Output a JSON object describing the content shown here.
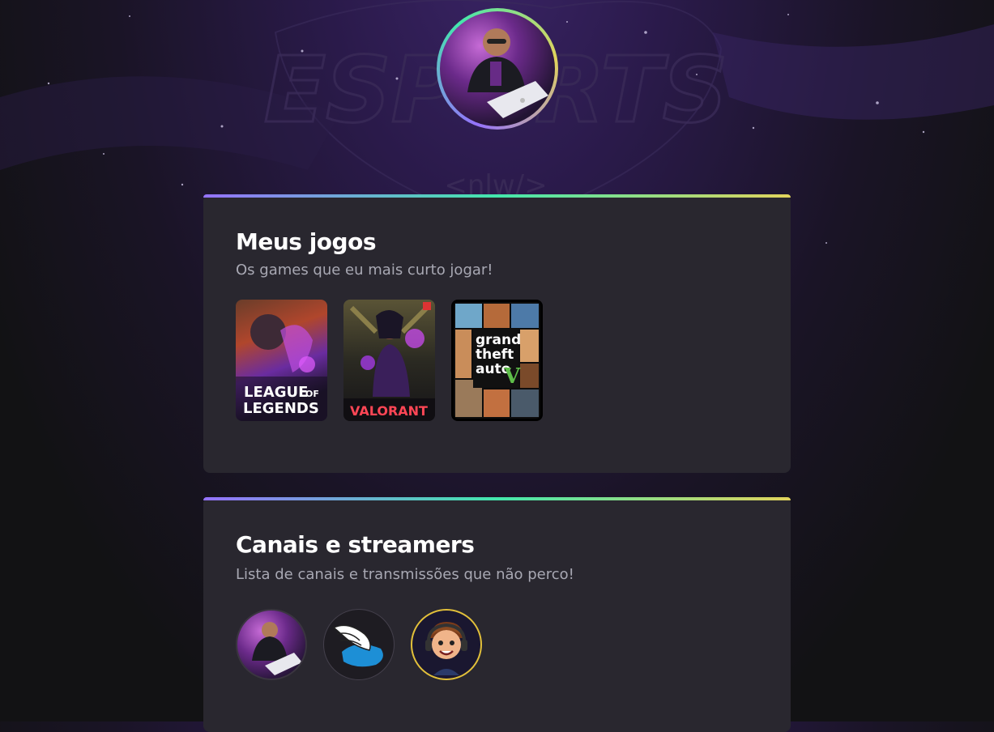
{
  "profile": {
    "avatar_icon": "person-at-laptop-avatar"
  },
  "background": {
    "watermark_main": "ESPORTS",
    "watermark_sub": "<nlw/>"
  },
  "games_card": {
    "title": "Meus jogos",
    "subtitle": "Os games que eu mais curto jogar!",
    "games": [
      {
        "name": "LEAGUE OF LEGENDS",
        "line1": "LEAGUE",
        "line1b": "OF",
        "line2": "LEGENDS"
      },
      {
        "name": "VALORANT",
        "logo": "VALORANT"
      },
      {
        "name": "Grand Theft Auto V",
        "line1": "grand",
        "line2": "theft",
        "line3": "auto",
        "numeral": "V"
      }
    ]
  },
  "streamers_card": {
    "title": "Canais e streamers",
    "subtitle": "Lista de canais e transmissões que não perco!",
    "streamers": [
      {
        "icon": "person-at-laptop-avatar"
      },
      {
        "icon": "winged-emblem-avatar"
      },
      {
        "icon": "cartoon-gamer-avatar"
      }
    ]
  },
  "colors": {
    "gradient_start": "#9572fc",
    "gradient_mid": "#43e7ad",
    "gradient_end": "#e2d45c",
    "card_bg": "#29272f"
  }
}
